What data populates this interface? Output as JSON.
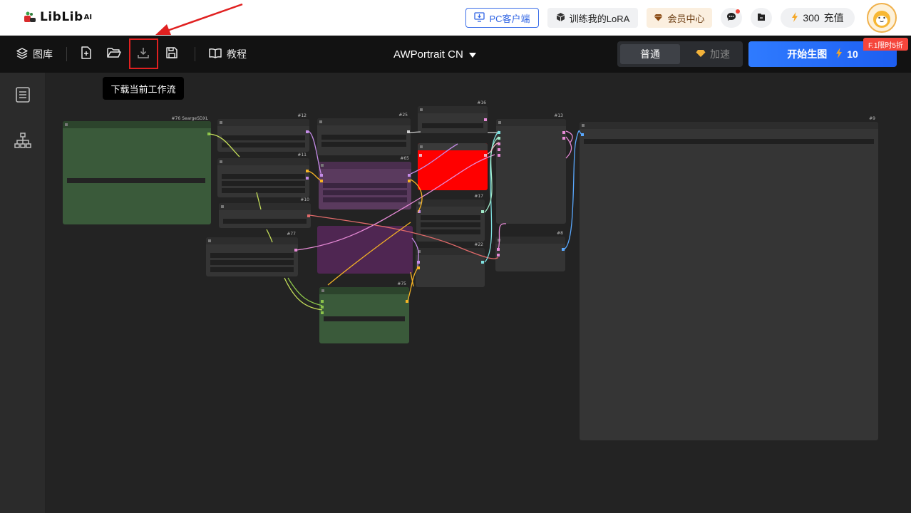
{
  "header": {
    "brand_name": "LibLib",
    "brand_suffix": "AI",
    "pc_client_label": "PC客户端",
    "train_lora_label": "训练我的LoRA",
    "vip_label": "会员中心",
    "credits_value": "300",
    "recharge_label": "充值"
  },
  "toolbar": {
    "gallery_label": "图库",
    "tutorial_label": "教程",
    "model_name": "AWPortrait CN",
    "mode_normal_label": "普通",
    "mode_fast_label": "加速",
    "generate_label": "开始生图",
    "generate_cost": "10",
    "promo_badge": "F.1限时5折",
    "download_tooltip": "下载当前工作流"
  },
  "nodes": {
    "n76": "#76 SeargeSDXL",
    "n12": "#12",
    "n11": "#11",
    "n10": "#10",
    "n77": "#77",
    "n25": "#25",
    "n65": "#65",
    "n75": "#75",
    "n16": "#16",
    "n17": "#17",
    "n22": "#22",
    "n13": "#13",
    "n8": "#8",
    "n9": "#9"
  },
  "colors": {
    "accent_blue": "#1d5ef0",
    "highlight_red": "#e02020",
    "node_green": "#3a5a3a",
    "node_purple": "#55305a",
    "node_red": "#ff0000"
  }
}
